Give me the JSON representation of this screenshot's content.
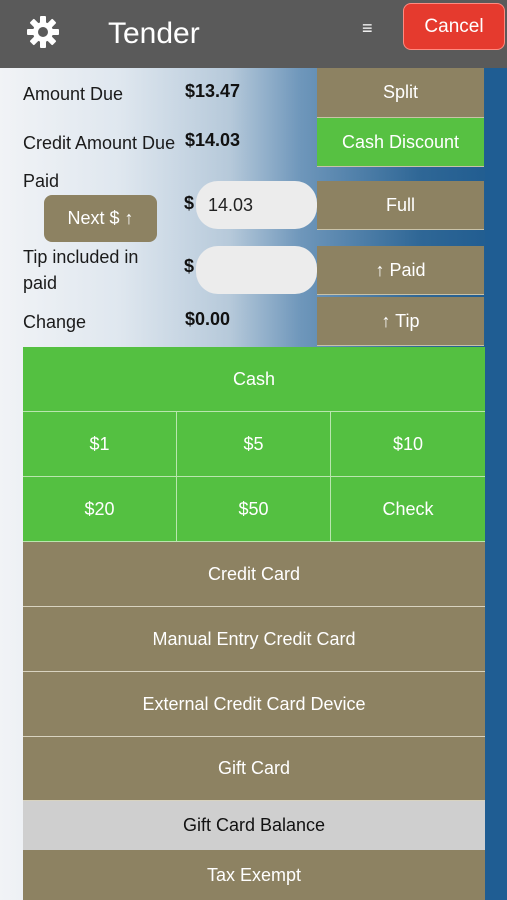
{
  "header": {
    "title": "Tender",
    "menu_glyph": "≡",
    "cancel_label": "Cancel",
    "gear_icon": "gear-icon",
    "colors": {
      "bar": "#5a5a5a",
      "cancel": "#e53a2e"
    }
  },
  "summary": {
    "amount_due_label": "Amount Due",
    "amount_due_value": "$13.47",
    "credit_amount_due_label": "Credit Amount Due",
    "credit_amount_due_value": "$14.03",
    "paid_label": "Paid",
    "paid_currency": "$",
    "paid_value": "14.03",
    "next_button": "Next $ ↑",
    "tip_label": "Tip included in paid",
    "tip_currency": "$",
    "tip_value": "",
    "change_label": "Change",
    "change_value": "$0.00"
  },
  "side_buttons": {
    "split": "Split",
    "cash_discount": "Cash Discount",
    "full": "Full",
    "up_paid": "↑ Paid",
    "up_tip": "↑ Tip"
  },
  "cash": {
    "label": "Cash",
    "amounts": [
      "$1",
      "$5",
      "$10",
      "$20",
      "$50",
      "Check"
    ]
  },
  "payment_methods": {
    "credit_card": "Credit Card",
    "manual_entry": "Manual Entry Credit Card",
    "external_device": "External Credit Card Device",
    "gift_card": "Gift Card",
    "gift_card_balance": "Gift Card Balance",
    "tax_exempt": "Tax Exempt"
  },
  "colors": {
    "green": "#54c041",
    "tan": "#8d8262",
    "gray": "#cfcfcf",
    "blue_edge": "#1f5d93"
  }
}
